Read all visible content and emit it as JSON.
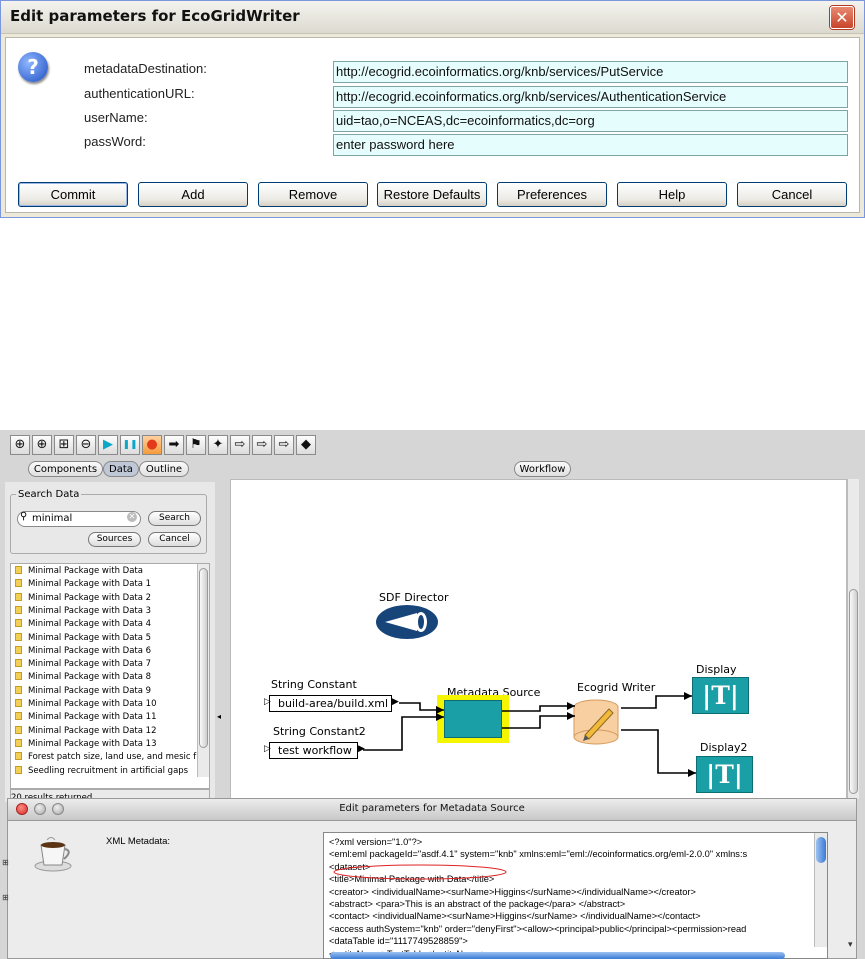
{
  "dialog1": {
    "title": "Edit parameters for EcoGridWriter",
    "close_glyph": "✕",
    "icon": "question-icon",
    "icon_glyph": "?",
    "params": [
      {
        "label": "metadataDestination:",
        "value": "http://ecogrid.ecoinformatics.org/knb/services/PutService"
      },
      {
        "label": "authenticationURL:",
        "value": "http://ecogrid.ecoinformatics.org/knb/services/AuthenticationService"
      },
      {
        "label": "userName:",
        "value": "uid=tao,o=NCEAS,dc=ecoinformatics,dc=org"
      },
      {
        "label": "passWord:",
        "value": "enter password here"
      }
    ],
    "buttons": [
      "Commit",
      "Add",
      "Remove",
      "Restore Defaults",
      "Preferences",
      "Help",
      "Cancel"
    ]
  },
  "toolbar": {
    "icons": [
      "zoom-in-icon",
      "zoom-reset-icon",
      "zoom-fit-icon",
      "zoom-out-icon",
      "run-icon",
      "pause-icon",
      "stop-icon",
      "arrow-right-icon",
      "flag-icon",
      "arrow-both-icon",
      "outline-arrow-icon",
      "outline-arrow2-icon",
      "outline-arrow3-icon",
      "diamond-icon"
    ],
    "glyphs": [
      "⊕",
      "⊕",
      "⊞",
      "⊖",
      "▶",
      "❚❚",
      "●",
      "➡",
      "⚑",
      "✦",
      "⇨",
      "⇨",
      "⇨",
      "◆"
    ]
  },
  "left_panel": {
    "tabs": [
      "Components",
      "Data",
      "Outline"
    ],
    "search_group_label": "Search Data",
    "search_value": "minimal",
    "search_button": "Search",
    "sources_button": "Sources",
    "cancel_button": "Cancel",
    "results": [
      "Minimal Package with Data",
      "Minimal Package with Data 1",
      "Minimal Package with Data 2",
      "Minimal Package with Data 3",
      "Minimal Package with Data 4",
      "Minimal Package with Data 5",
      "Minimal Package with Data 6",
      "Minimal Package with Data 7",
      "Minimal Package with Data 8",
      "Minimal Package with Data 9",
      "Minimal Package with Data 10",
      "Minimal Package with Data 11",
      "Minimal Package with Data 12",
      "Minimal Package with Data 13",
      "Forest patch size, land use, and mesic f",
      "Seedling recruitment in artificial gaps"
    ],
    "status": "20 results returned"
  },
  "workflow": {
    "tab_label": "Workflow",
    "director_label": "SDF Director",
    "string_constant_label": "String Constant",
    "string_constant_value": "build-area/build.xml",
    "string_constant2_label": "String Constant2",
    "string_constant2_value": "test workflow",
    "metadata_source_label": "Metadata Source",
    "ecogrid_writer_label": "Ecogrid Writer",
    "display_label": "Display",
    "display2_label": "Display2",
    "display_glyph": "|T|"
  },
  "dialog2": {
    "title": "Edit parameters for Metadata Source",
    "field_label": "XML Metadata:",
    "xml_lines": [
      "<?xml version=\"1.0\"?>",
      "<eml:eml packageId=\"asdf.4.1\" system=\"knb\" xmlns:eml=\"eml://ecoinformatics.org/eml-2.0.0\" xmlns:s",
      "<dataset>",
      "<title>Minimal Package with Data</title>",
      "<creator> <individualName><surName>Higgins</surName></individualName></creator>",
      "<abstract> <para>This is an abstract of the package</para> </abstract>",
      "<contact> <individualName><surName>Higgins</surName> </individualName></contact>",
      "<access authSystem=\"knb\" order=\"denyFirst\"><allow><principal>public</principal><permission>read",
      "<dataTable id=\"1117749528859\">",
      "<entityName>TestTable</entityName>"
    ]
  },
  "colors": {
    "field_bg": "#e6fdfd",
    "teal": "#1b9fa6",
    "selection_yellow": "#f5f500",
    "director_blue": "#17457a"
  }
}
